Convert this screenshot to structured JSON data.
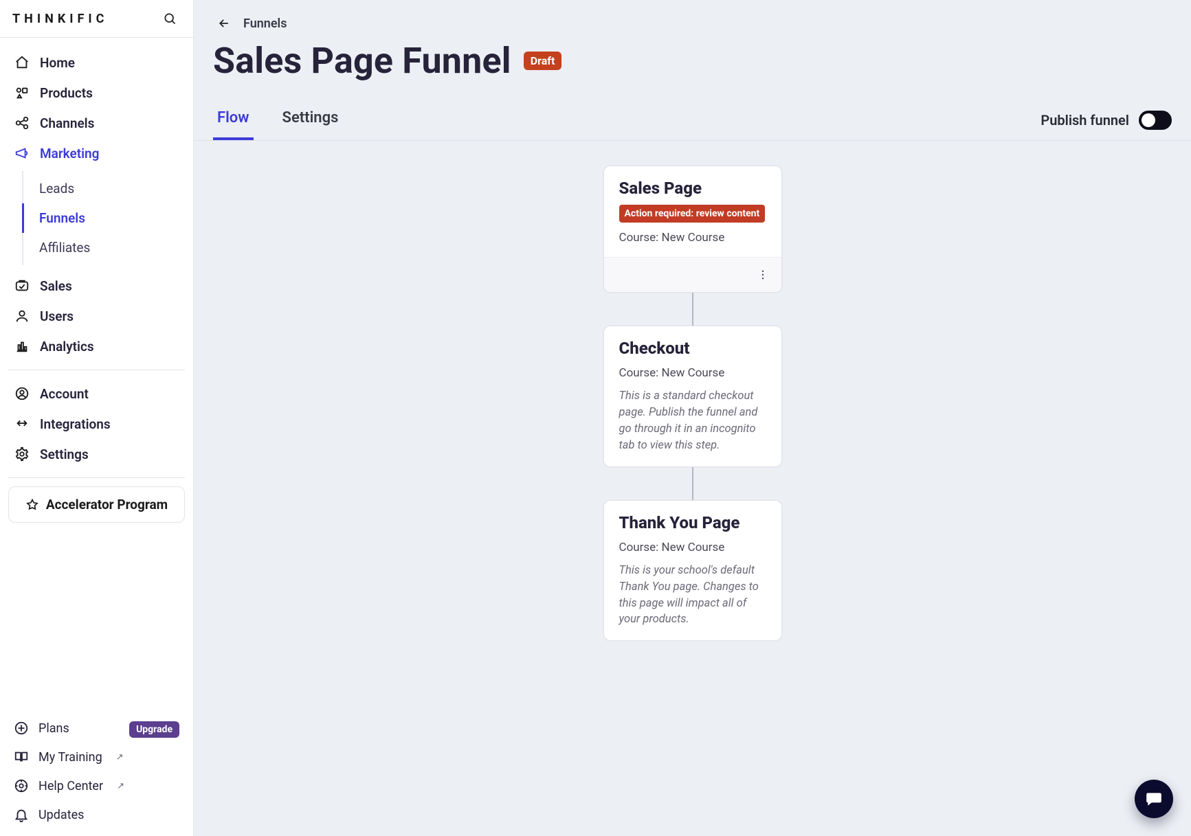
{
  "brand": {
    "logo_text": "THINKIFIC"
  },
  "sidebar": {
    "items": [
      {
        "id": "home",
        "label": "Home"
      },
      {
        "id": "products",
        "label": "Products"
      },
      {
        "id": "channels",
        "label": "Channels"
      },
      {
        "id": "marketing",
        "label": "Marketing",
        "active": true
      },
      {
        "id": "sales",
        "label": "Sales"
      },
      {
        "id": "users",
        "label": "Users"
      },
      {
        "id": "analytics",
        "label": "Analytics"
      },
      {
        "id": "account",
        "label": "Account"
      },
      {
        "id": "integrations",
        "label": "Integrations"
      },
      {
        "id": "settings",
        "label": "Settings"
      }
    ],
    "marketing_sub": [
      {
        "id": "leads",
        "label": "Leads"
      },
      {
        "id": "funnels",
        "label": "Funnels",
        "active": true
      },
      {
        "id": "affiliates",
        "label": "Affiliates"
      }
    ],
    "accelerator_label": "Accelerator Program",
    "footer": {
      "plans_label": "Plans",
      "upgrade_label": "Upgrade",
      "my_training_label": "My Training",
      "help_center_label": "Help Center",
      "updates_label": "Updates"
    }
  },
  "header": {
    "breadcrumb_back_label": "Funnels",
    "title": "Sales Page Funnel",
    "status_badge": "Draft",
    "tabs": {
      "flow": "Flow",
      "settings": "Settings",
      "active": "flow"
    },
    "publish_label": "Publish funnel",
    "publish_on": false
  },
  "flow": {
    "cards": [
      {
        "id": "sales-page",
        "title": "Sales Page",
        "action_badge": "Action required: review content",
        "meta": "Course: New Course",
        "has_menu": true
      },
      {
        "id": "checkout",
        "title": "Checkout",
        "meta": "Course: New Course",
        "note": "This is a standard checkout page. Publish the funnel and go through it in an incognito tab to view this step."
      },
      {
        "id": "thank-you",
        "title": "Thank You Page",
        "meta": "Course: New Course",
        "note": "This is your school's default Thank You page. Changes to this page will impact all of your products."
      }
    ]
  }
}
